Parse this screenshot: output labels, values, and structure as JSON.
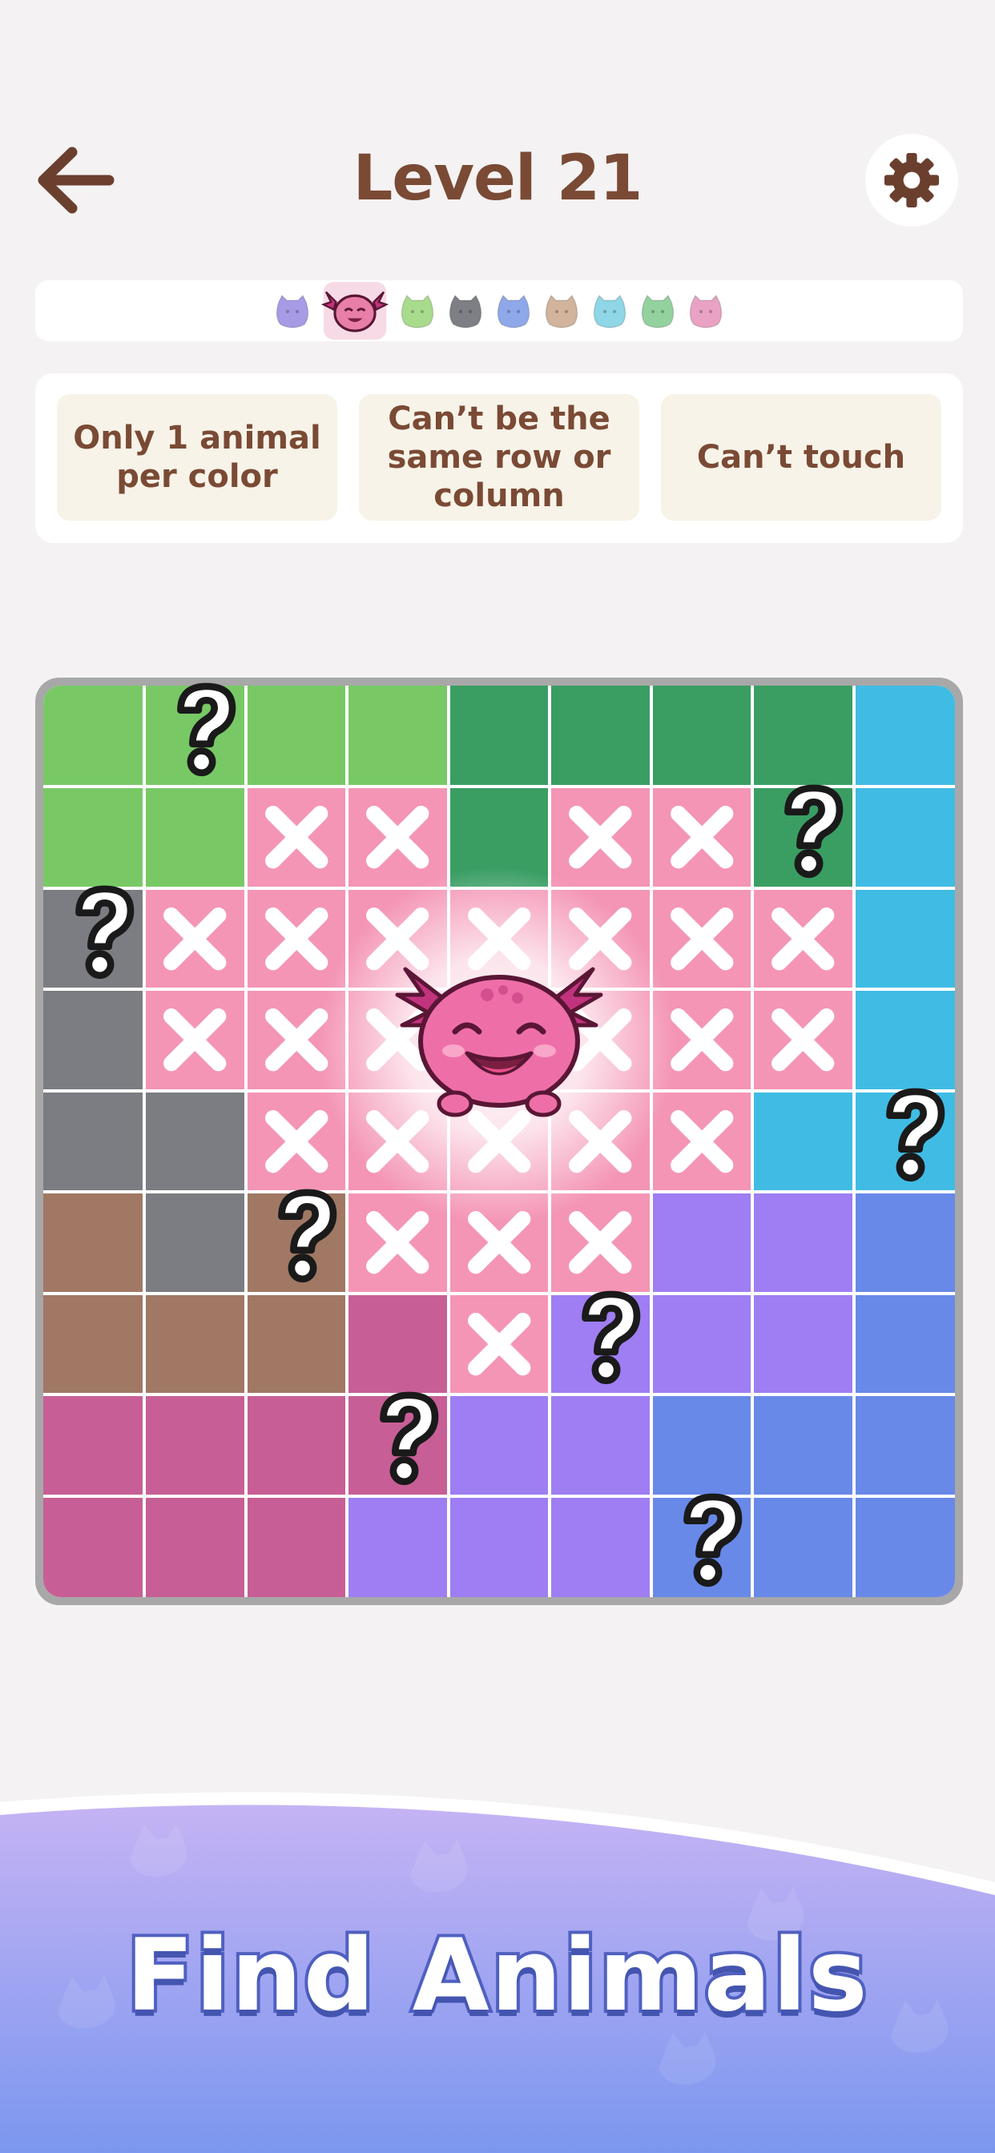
{
  "header": {
    "title": "Level 21",
    "back_icon": "arrow-left-icon",
    "settings_icon": "gear-icon"
  },
  "animal_strip": {
    "animals": [
      {
        "name": "purple-creature-icon",
        "color": "#a79be6",
        "active": false
      },
      {
        "name": "axolotl-icon",
        "color": "#e77fa8",
        "active": true
      },
      {
        "name": "green-blob-icon",
        "color": "#a8dc8c",
        "active": false
      },
      {
        "name": "gray-bunny-icon",
        "color": "#7d7f84",
        "active": false
      },
      {
        "name": "blue-creature-icon",
        "color": "#8fa8ea",
        "active": false
      },
      {
        "name": "brown-creature-icon",
        "color": "#d2b39b",
        "active": false
      },
      {
        "name": "cyan-creature-icon",
        "color": "#8fd6e6",
        "active": false
      },
      {
        "name": "green-creature-icon",
        "color": "#93d29e",
        "active": false
      },
      {
        "name": "pink-blob-icon",
        "color": "#e9a2c4",
        "active": false
      }
    ]
  },
  "rules": [
    {
      "label": "Only 1 animal per color"
    },
    {
      "label": "Can’t be the same row or column"
    },
    {
      "label": "Can’t touch"
    }
  ],
  "palette": {
    "L": "#78c966",
    "D": "#3a9e63",
    "C": "#40bce4",
    "G": "#7b7d82",
    "P": "#f495b5",
    "B": "#a07864",
    "M": "#c75f96",
    "V": "#9e7ef2",
    "U": "#6889e8"
  },
  "board": {
    "size": 9,
    "grid": [
      [
        "L",
        "L",
        "L",
        "L",
        "D",
        "D",
        "D",
        "D",
        "C"
      ],
      [
        "L",
        "L",
        "P",
        "P",
        "D",
        "P",
        "P",
        "D",
        "C"
      ],
      [
        "G",
        "P",
        "P",
        "P",
        "P",
        "P",
        "P",
        "P",
        "C"
      ],
      [
        "G",
        "P",
        "P",
        "P",
        "P",
        "P",
        "P",
        "P",
        "C"
      ],
      [
        "G",
        "G",
        "P",
        "P",
        "P",
        "P",
        "P",
        "C",
        "C"
      ],
      [
        "B",
        "G",
        "B",
        "P",
        "P",
        "P",
        "V",
        "V",
        "U"
      ],
      [
        "B",
        "B",
        "B",
        "M",
        "P",
        "V",
        "V",
        "V",
        "U"
      ],
      [
        "M",
        "M",
        "M",
        "M",
        "V",
        "V",
        "U",
        "U",
        "U"
      ],
      [
        "M",
        "M",
        "M",
        "V",
        "V",
        "V",
        "U",
        "U",
        "U"
      ]
    ],
    "marks": [
      [
        0,
        0,
        0,
        0,
        0,
        0,
        0,
        0,
        0
      ],
      [
        0,
        0,
        1,
        1,
        0,
        1,
        1,
        0,
        0
      ],
      [
        0,
        1,
        1,
        1,
        1,
        1,
        1,
        1,
        0
      ],
      [
        0,
        1,
        1,
        1,
        1,
        1,
        1,
        1,
        0
      ],
      [
        0,
        0,
        1,
        1,
        1,
        1,
        1,
        0,
        0
      ],
      [
        0,
        0,
        0,
        1,
        1,
        1,
        0,
        0,
        0
      ],
      [
        0,
        0,
        0,
        0,
        1,
        0,
        0,
        0,
        0
      ],
      [
        0,
        0,
        0,
        0,
        0,
        0,
        0,
        0,
        0
      ],
      [
        0,
        0,
        0,
        0,
        0,
        0,
        0,
        0,
        0
      ]
    ],
    "question_cells": [
      [
        0,
        1
      ],
      [
        1,
        7
      ],
      [
        2,
        0
      ],
      [
        4,
        8
      ],
      [
        5,
        2
      ],
      [
        6,
        5
      ],
      [
        7,
        3
      ],
      [
        8,
        6
      ]
    ],
    "found_animal": {
      "name": "axolotl-icon",
      "row": 3,
      "col": 4
    }
  },
  "banner": {
    "title": "Find Animals",
    "color_top": "#c5b3f4",
    "color_bottom": "#7b97ef"
  }
}
